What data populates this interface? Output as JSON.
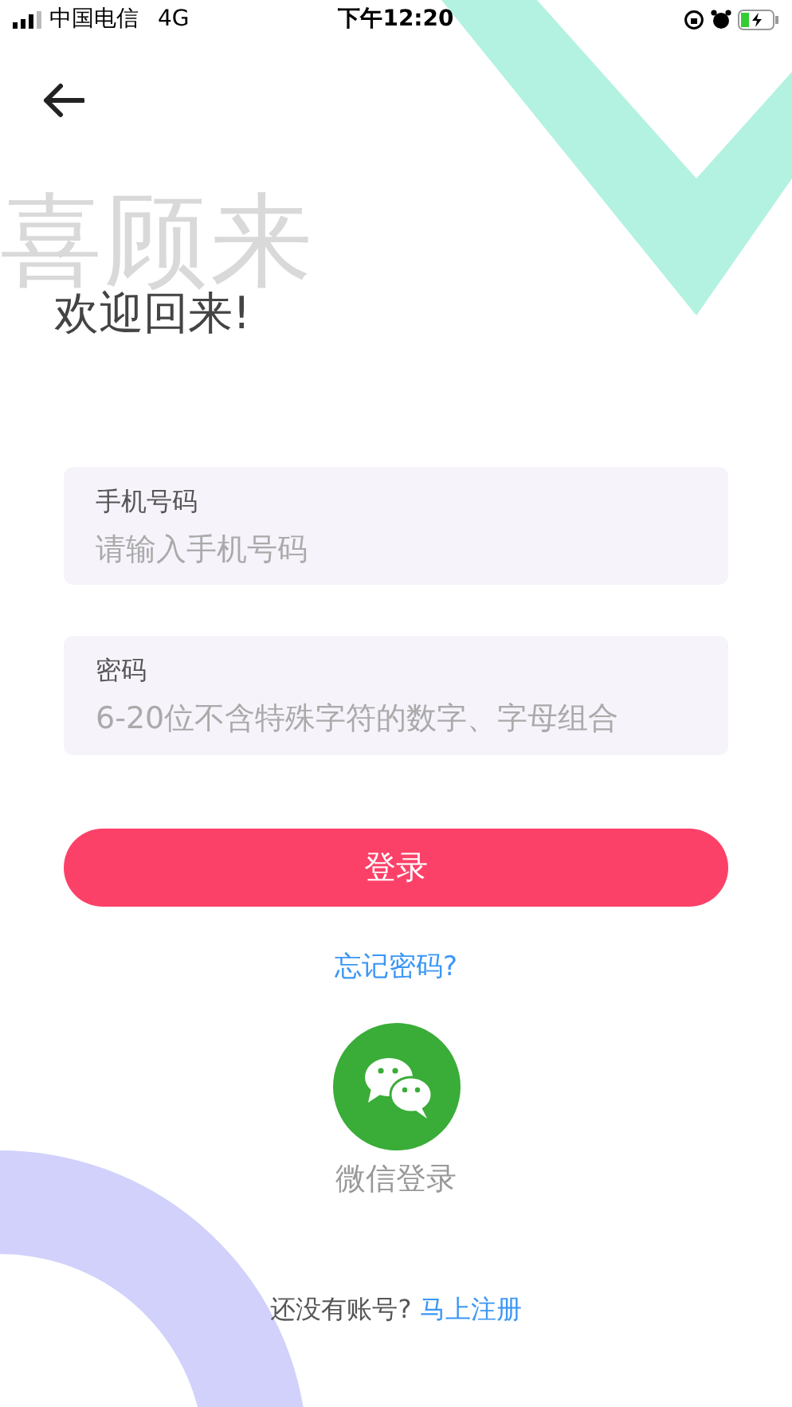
{
  "status_bar": {
    "carrier": "中国电信",
    "network": "4G",
    "time": "下午12:20"
  },
  "background_text": "喜顾来",
  "title": "欢迎回来!",
  "fields": [
    {
      "label": "手机号码",
      "placeholder": "请输入手机号码"
    },
    {
      "label": "密码",
      "placeholder": "6-20位不含特殊字符的数字、字母组合"
    }
  ],
  "login_button": "登录",
  "forgot_link": "忘记密码?",
  "wechat_label": "微信登录",
  "register": {
    "prompt": "还没有账号?",
    "link": "马上注册"
  }
}
